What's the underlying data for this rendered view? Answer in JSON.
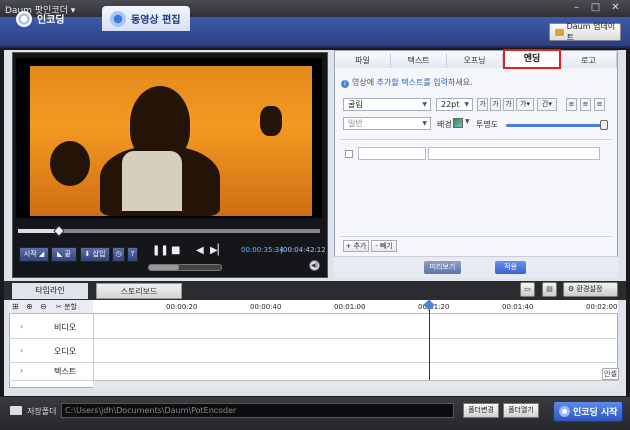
{
  "window": {
    "title": "Daum 팟인코더 ▾"
  },
  "top_tabs": {
    "encode": "인코딩",
    "edit": "동영상 편집"
  },
  "update_button": "Daum 업데이트",
  "player": {
    "start_btn": "시작 ◢",
    "end_btn": "◣ 끝",
    "insert_btn": "⬇ 삽입",
    "clock_btn": "◷",
    "help_btn": "?",
    "time_current": "00:00:35:34",
    "time_total": "00:04:42:12"
  },
  "right_tabs": [
    "파일",
    "텍스트",
    "오프닝",
    "엔딩",
    "로고"
  ],
  "ending": {
    "hint_prefix": "영상에 ",
    "hint_link": "추가할 텍스트를 입력",
    "hint_suffix": "하세요.",
    "font": "굴림",
    "size": "22pt",
    "style": "일반",
    "bg_label": "배경",
    "transparency": "투명도",
    "add_btn": "+ 추가",
    "del_btn": "- 빼기",
    "preview_btn": "미리보기",
    "apply_btn": "적용"
  },
  "timeline": {
    "tab_timeline": "타임라인",
    "tab_storyboard": "스토리보드",
    "split_btn": "분할",
    "env_settings": "환경설정",
    "ticks": [
      "00:00:20",
      "00:00:40",
      "00:01:00",
      "00:01:20",
      "00:01:40",
      "00:02:00"
    ],
    "tracks": [
      "비디오",
      "오디오",
      "텍스트"
    ],
    "overflow_label": "인셀"
  },
  "bottom": {
    "save_folder_label": "저장폴더",
    "path": "C:\\Users\\jdh\\Documents\\Daum\\PotEncoder",
    "change_folder": "폴더변경",
    "open_folder": "폴더열기",
    "start_encoding": "인코딩 시작"
  },
  "colors": {
    "accent_blue": "#2e56c0",
    "ending_highlight": "#e02020",
    "video_orange": "#f39a22"
  }
}
